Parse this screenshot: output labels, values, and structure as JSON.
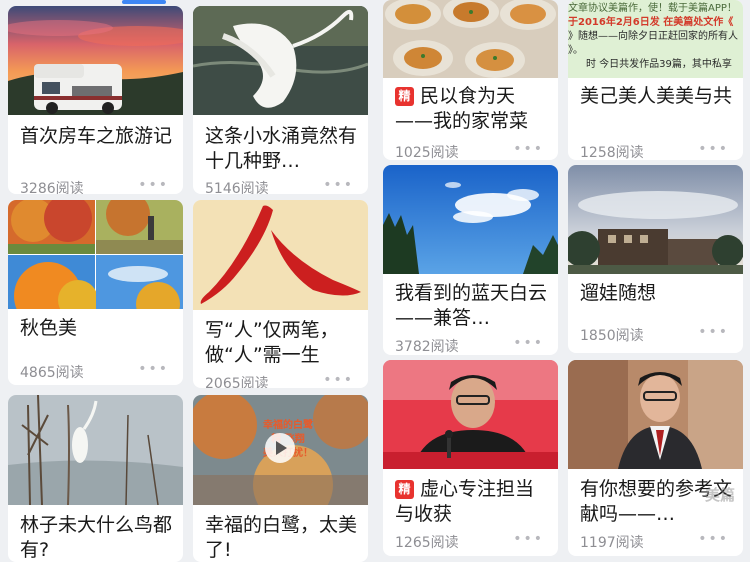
{
  "feed": {
    "cards": [
      {
        "title": "首次房车之旅游记",
        "reads": "3286阅读",
        "more": "•••"
      },
      {
        "title": "这条小水涌竟然有十几种野…",
        "reads": "5146阅读",
        "more": "•••"
      },
      {
        "title": "秋色美",
        "reads": "4865阅读",
        "more": "•••"
      },
      {
        "title": "写“人”仅两笔，做“人”需一生",
        "reads": "2065阅读",
        "more": "•••"
      },
      {
        "title": "林子未大什么鸟都有?",
        "reads": "",
        "more": ""
      },
      {
        "title": "幸福的白鹭，太美了!",
        "reads": "",
        "more": ""
      },
      {
        "title": "民以食为天——我的家常菜",
        "badge": "精",
        "reads": "1025阅读",
        "more": "•••",
        "thumb_text": {
          "line1": "文章协议美篇作，使！载于美篇APP！",
          "line2": "于2016年2月6日发 在美篇处文作《",
          "line3": "》随想——向除夕日正赶回家的所有人",
          "line4": "》。",
          "line5": "时 今日共发作品39篇，其中私享"
        }
      },
      {
        "title": "美己美人美美与共",
        "reads": "1258阅读",
        "more": "•••"
      },
      {
        "title": "我看到的蓝天白云——兼答…",
        "reads": "3782阅读",
        "more": "•••"
      },
      {
        "title": "遛娃随想",
        "reads": "1850阅读",
        "more": "•••"
      },
      {
        "title": "虚心专注担当与收获",
        "badge": "精",
        "reads": "1265阅读",
        "more": "•••"
      },
      {
        "title": "有你想要的参考文献吗——…",
        "reads": "1197阅读",
        "more": "•••"
      }
    ],
    "video_overlay": {
      "line1": "幸福的白鹭",
      "line2": "精",
      "line3": "飞翔",
      "line4": "美人打扰！"
    },
    "watermark": "美篇"
  }
}
